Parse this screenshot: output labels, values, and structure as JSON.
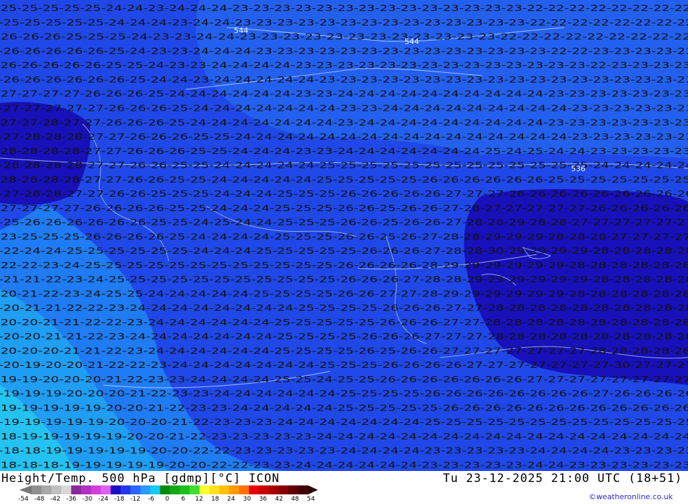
{
  "title_left": "Height/Temp. 500 hPa [gdmp][°C] ICON",
  "title_right": "Tu 23-12-2025 21:00 UTC (18+51)",
  "credit": "©weatheronline.co.uk",
  "legend": {
    "ticks": [
      "-54",
      "-48",
      "-42",
      "-36",
      "-30",
      "-24",
      "-18",
      "-12",
      "-6",
      "0",
      "6",
      "12",
      "18",
      "24",
      "30",
      "36",
      "42",
      "48",
      "54"
    ],
    "colors": [
      "#909090",
      "#a8a8a8",
      "#c0c0c0",
      "#d8d8d8",
      "#8a2a9a",
      "#b030c0",
      "#d040d8",
      "#e060f0",
      "#1a10c0",
      "#2238e8",
      "#2a66ff",
      "#2a9aff",
      "#18c8f8",
      "#0a8a0a",
      "#14a814",
      "#1cc01c",
      "#40dc30",
      "#ffff30",
      "#ffe020",
      "#ffc000",
      "#ff9a00",
      "#ff7000",
      "#e80000",
      "#c80000",
      "#a80000",
      "#880000",
      "#600000",
      "#400000"
    ]
  },
  "map_colors": {
    "band_minus_18": "#24c2f0",
    "band_minus_19": "#1f9ef4",
    "band_minus_20": "#1f7cf4",
    "band_minus_23": "#2460f0",
    "band_minus_25": "#2048e8",
    "band_minus_27": "#1810b8",
    "contour": "#dde8ff",
    "boundary": "#8fa8e8"
  },
  "height_labels": [
    "544",
    "544",
    "536"
  ],
  "temperature_rows": [
    "-25-25-25-25-25-24-24-23-24-24-24-23-23-23-23-23-23-23-23-23-23-23-23-23-23-22-22-22-22-22-22-22-22",
    "-25-25-25-25-25-24-24-24-23-24-24-23-23-23-23-23-23-23-23-23-23-23-23-23-23-22-22-22-22-22-22-22-22",
    "-26-26-26-25-25-25-24-23-23-24-24-23-23-23-23-23-23-23-23-23-23-23-23-22-22-22-22-22-22-22-22-22",
    "-26-26-26-26-26-25-24-23-23-24-24-24-23-23-23-23-23-23-23-23-23-23-23-23-23-23-22-22-23-23-23-23-23",
    "-26-26-26-26-26-25-25-24-23-23-24-24-24-24-23-23-23-23-23-23-23-23-23-23-23-23-23-23-22-23-23-23-23",
    "-26-26-26-26-26-26-25-24-24-23-24-24-24-24-24-23-23-23-23-23-23-23-23-23-23-23-23-23-23-23-23-23-23",
    "-27-27-27-27-26-26-26-25-24-24-24-24-24-24-23-23-24-24-24-24-24-24-24-24-24-24-23-23-23-23-23-23-23",
    "-27-27-27-27-27-26-26-26-25-24-24-24-24-24-24-24-23-23-24-24-24-24-24-24-24-24-24-23-23-23-23-23-23",
    "-27-27-28-27-27-26-26-26-25-24-24-24-24-24-24-24-23-24-24-24-24-24-24-24-24-24-23-23-23-23-23-23-23",
    "-27-28-28-28-27-27-26-26-26-25-25-24-24-24-24-24-24-24-24-24-24-24-24-24-24-24-24-23-23-23-23-23-23",
    "-28-28-28-28-27-27-26-26-26-25-25-24-24-24-23-23-24-24-24-24-24-24-24-25-24-25-24-24-23-23-23-23-23",
    "-28-28-28-28-27-27-26-26-25-25-24-24-24-24-24-25-25-25-25-25-25-25-25-25-25-25-25-25-24-24-24-24-24",
    "-28-28-28-28-27-27-26-26-25-25-24-24-24-24-24-25-25-25-25-25-26-26-26-26-26-26-25-25-25-25-25-25-25",
    "-27-28-28-27-27-26-26-25-25-25-24-24-24-25-25-25-26-26-26-26-26-27-27-27-26-26-26-26-26-26-26-26-26",
    "-27-27-27-27-26-26-26-26-25-25-24-24-24-25-25-25-26-26-25-26-26-27-28-27-27-27-27-27-26-26-26-26-26",
    "-25-26-26-26-26-26-26-25-25-24-25-24-24-25-25-25-26-26-25-26-26-27-28-28-29-28-28-27-27-27-27-27-27",
    "-23-25-25-25-26-26-26-26-25-24-24-24-24-25-25-25-26-26-25-26-27-28-28-29-29-29-28-28-28-27-27-27-27",
    "-22-24-24-25-25-25-25-25-25-24-24-24-25-25-25-25-25-26-26-26-27-28-28-30-29-29-29-29-28-28-28-28-28",
    "-22-22-23-24-25-25-25-25-25-25-25-25-25-25-25-25-26-26-26-26-28-29-29-29-29-29-29-28-28-28-28-28-28",
    "-21-21-22-23-24-25-25-25-25-25-25-25-25-25-25-25-26-26-26-27-28-28-29-29-29-29-29-29-28-28-28-28-28",
    "-20-21-22-23-24-25-25-24-24-24-24-24-25-25-25-25-26-26-27-27-28-29-29-29-29-29-29-28-28-28-28-28-28",
    "-20-21-21-22-22-23-24-24-24-24-24-24-24-24-25-25-25-25-26-26-26-27-27-28-28-28-28-28-28-28-28-28-28",
    "-20-20-21-21-22-22-23-24-24-24-24-24-24-25-25-25-25-25-26-26-26-27-27-28-28-28-28-28-28-28-28-28-28",
    "-20-20-21-21-22-23-24-24-24-24-24-24-24-25-25-25-25-26-26-26-27-27-27-28-28-28-28-28-28-28-28-28-28",
    "-20-20-20-21-21-22-23-24-24-24-24-24-24-25-25-25-25-26-25-26-26-27-27-27-27-27-27-27-28-28-28-28-28",
    "-20-19-20-20-21-22-22-23-24-24-24-24-24-24-24-25-25-25-26-26-26-26-27-27-27-27-27-27-27-30-27-27-27",
    "-19-19-20-20-20-21-22-23-23-24-24-24-24-25-25-24-25-25-26-26-26-26-26-26-26-27-27-27-27-27-27-27-27",
    "-19-19-19-20-20-20-21-22-23-23-24-24-24-24-24-24-25-25-25-25-26-26-26-26-26-26-26-26-27-26-26-26-26",
    "-19-19-19-19-19-20-20-21-22-23-23-24-24-24-24-24-25-25-25-25-25-26-26-26-26-26-26-26-26-26-26-26-26",
    "-19-19-19-19-19-20-20-20-21-22-23-23-23-24-24-24-24-24-24-24-25-25-25-25-25-25-25-25-25-25-25-25-25",
    "-18-19-19-19-19-19-20-20-21-22-23-23-23-23-23-24-24-24-24-24-24-24-24-24-24-24-24-24-24-24-24-24-24",
    "-18-18-19-19-19-19-19-20-20-22-22-23-23-23-23-23-24-24-24-24-23-23-23-23-23-24-24-24-24-23-23-23-23",
    "-18-18-18-19-19-19-19-19-20-20-22-22-23-23-24-24-24-24-24-24-23-23-23-23-23-24-24-23-23-23-23-23-23"
  ]
}
